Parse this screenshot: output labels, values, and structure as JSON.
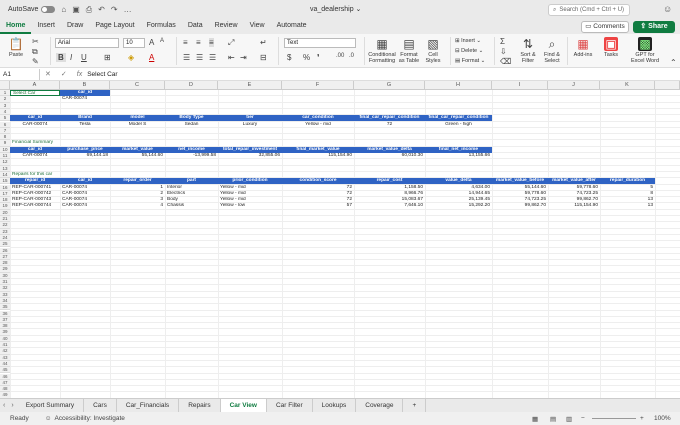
{
  "titlebar": {
    "autosave": "AutoSave",
    "doc_title": "va_dealership",
    "search_placeholder": "Search (Cmd + Ctrl + U)"
  },
  "tabs": [
    "Home",
    "Insert",
    "Draw",
    "Page Layout",
    "Formulas",
    "Data",
    "Review",
    "View",
    "Automate"
  ],
  "actions": {
    "comments": "Comments",
    "share": "Share"
  },
  "ribbon": {
    "paste": "Paste",
    "font": "Arial",
    "size": "10",
    "number_format": "Text",
    "conditional": [
      "Conditional",
      "Formatting"
    ],
    "format_table": [
      "Format",
      "as Table"
    ],
    "cell_styles": [
      "Cell",
      "Styles"
    ],
    "insert": "Insert",
    "delete": "Delete",
    "format": "Format",
    "sort": [
      "Sort &",
      "Filter"
    ],
    "find": [
      "Find &",
      "Select"
    ],
    "addins": "Add-ins",
    "tasks": "Tasks",
    "gpt": [
      "GPT for",
      "Excel Word"
    ]
  },
  "formula_bar": {
    "cell_ref": "A1",
    "value": "Select Car"
  },
  "columns": [
    "A",
    "B",
    "C",
    "D",
    "E",
    "F",
    "G",
    "H",
    "I",
    "J",
    "K"
  ],
  "cells": {
    "r1": [
      "Select Car",
      "car_id"
    ],
    "r2": [
      "",
      "CAR-00074"
    ],
    "r5": [
      "car_id",
      "Brand",
      "model",
      "Body Type",
      "tier",
      "car_condition",
      "final_car_repair_condition",
      "final_car_repair_condition"
    ],
    "r6": [
      "CAR-00074",
      "Tesla",
      "Model S",
      "Sedan",
      "Luxury",
      "Yellow - mid",
      "72",
      "Green - high"
    ],
    "r9": "Financial Summary",
    "r10": [
      "car_id",
      "purchase_price",
      "market_value",
      "net_income",
      "total_repair_investment",
      "final_market_value",
      "market_value_delta",
      "final_net_income"
    ],
    "r11": [
      "CAR-00074",
      "69,144.18",
      "55,144.60",
      "-13,999.58",
      "32,855.06",
      "115,154.90",
      "60,010.30",
      "13,155.66"
    ],
    "r14": "Repairs for this car",
    "r15": [
      "repair_id",
      "car_id",
      "repair_order",
      "part",
      "prior_condition",
      "condition_score",
      "repair_cost",
      "value_delta",
      "market_value_before",
      "market_value_after",
      "repair_duration"
    ],
    "repairs": [
      [
        "REP-CAR-000741",
        "CAR-00074",
        "1",
        "Interior",
        "Yellow - mid",
        "72",
        "1,158.50",
        "4,634.00",
        "55,144.60",
        "59,778.60",
        "5"
      ],
      [
        "REP-CAR-000742",
        "CAR-00074",
        "2",
        "Electrics",
        "Yellow - mid",
        "72",
        "8,966.76",
        "14,944.65",
        "59,778.60",
        "74,723.25",
        "8"
      ],
      [
        "REP-CAR-000743",
        "CAR-00074",
        "3",
        "Body",
        "Yellow - mid",
        "72",
        "15,083.67",
        "25,139.45",
        "74,723.25",
        "99,862.70",
        "13"
      ],
      [
        "REP-CAR-000744",
        "CAR-00074",
        "4",
        "Chassis",
        "Yellow - low",
        "57",
        "7,646.10",
        "15,292.20",
        "99,862.70",
        "115,154.90",
        "13"
      ]
    ]
  },
  "sheets": [
    "Export Summary",
    "Cars",
    "Car_Financials",
    "Repairs",
    "Car View",
    "Car Filter",
    "Lookups",
    "Coverage"
  ],
  "active_sheet": "Car View",
  "status": {
    "ready": "Ready",
    "accessibility": "Accessibility: Investigate",
    "zoom": "100%"
  }
}
